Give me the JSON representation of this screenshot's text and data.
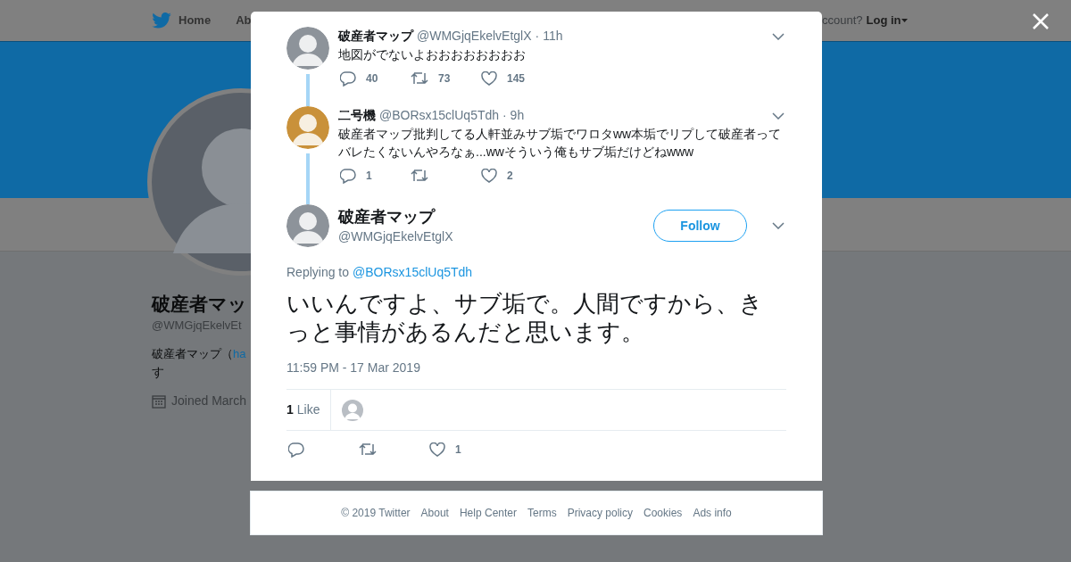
{
  "header": {
    "nav": [
      "Home",
      "Ab"
    ],
    "login_prompt": "ccount?",
    "login": "Log in"
  },
  "profile": {
    "name": "破産者マッ",
    "handle": "@WMGjqEkelvEt",
    "bio": "破産者マップ（",
    "bio_link": "ha",
    "bio_line2": "す",
    "joined": "Joined March"
  },
  "thread": [
    {
      "name": "破産者マップ",
      "handle": "@WMGjqEkelvEtglX",
      "time": "· 11h",
      "text": "地図がでないよおおおおおおおお",
      "replies": "40",
      "retweets": "73",
      "likes": "145"
    },
    {
      "name": "二号機",
      "handle": "@BORsx15clUq5Tdh",
      "time": "· 9h",
      "text": "破産者マップ批判してる人軒並みサブ垢でワロタww本垢でリプして破産者ってバレたくないんやろなぁ...wwそういう俺もサブ垢だけどねwww",
      "replies": "1",
      "likes": "2"
    }
  ],
  "focus": {
    "name": "破産者マップ",
    "handle": "@WMGjqEkelvEtglX",
    "follow": "Follow",
    "replying_label": "Replying to",
    "replying_to": "@BORsx15clUq5Tdh",
    "text": "いいんですよ、サブ垢で。人間ですから、きっと事情があるんだと思います。",
    "timestamp": "11:59 PM - 17 Mar 2019",
    "likes_count": "1",
    "likes_label": "Like",
    "likes": "1"
  },
  "footer": [
    "© 2019 Twitter",
    "About",
    "Help Center",
    "Terms",
    "Privacy policy",
    "Cookies",
    "Ads info"
  ]
}
